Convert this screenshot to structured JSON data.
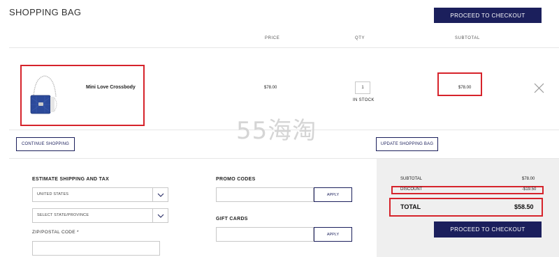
{
  "header": {
    "title": "SHOPPING BAG",
    "checkout_label": "PROCEED TO CHECKOUT"
  },
  "columns": {
    "price": "PRICE",
    "qty": "QTY",
    "subtotal": "SUBTOTAL"
  },
  "item": {
    "name": "Mini Love Crossbody",
    "price": "$78.00",
    "qty": "1",
    "stock": "IN STOCK",
    "subtotal": "$78.00"
  },
  "actions": {
    "continue_label": "CONTINUE SHOPPING",
    "update_label": "UPDATE SHOPPING BAG"
  },
  "shipping": {
    "heading": "ESTIMATE SHIPPING AND TAX",
    "country": "UNITED STATES",
    "state": "SELECT STATE/PROVINCE",
    "zip_label": "ZIP/POSTAL CODE *"
  },
  "promo": {
    "heading": "PROMO CODES",
    "apply": "APPLY",
    "gift_heading": "GIFT CARDS",
    "gift_apply": "APPLY"
  },
  "summary": {
    "subtotal_label": "SUBTOTAL",
    "subtotal_value": "$78.00",
    "discount_label": "DISCOUNT",
    "discount_value": "-$19.50",
    "total_label": "TOTAL",
    "total_value": "$58.50",
    "checkout_label": "PROCEED TO CHECKOUT"
  },
  "watermark": "55海淘",
  "colors": {
    "brand": "#1b1f5c",
    "highlight": "#d6232b"
  }
}
